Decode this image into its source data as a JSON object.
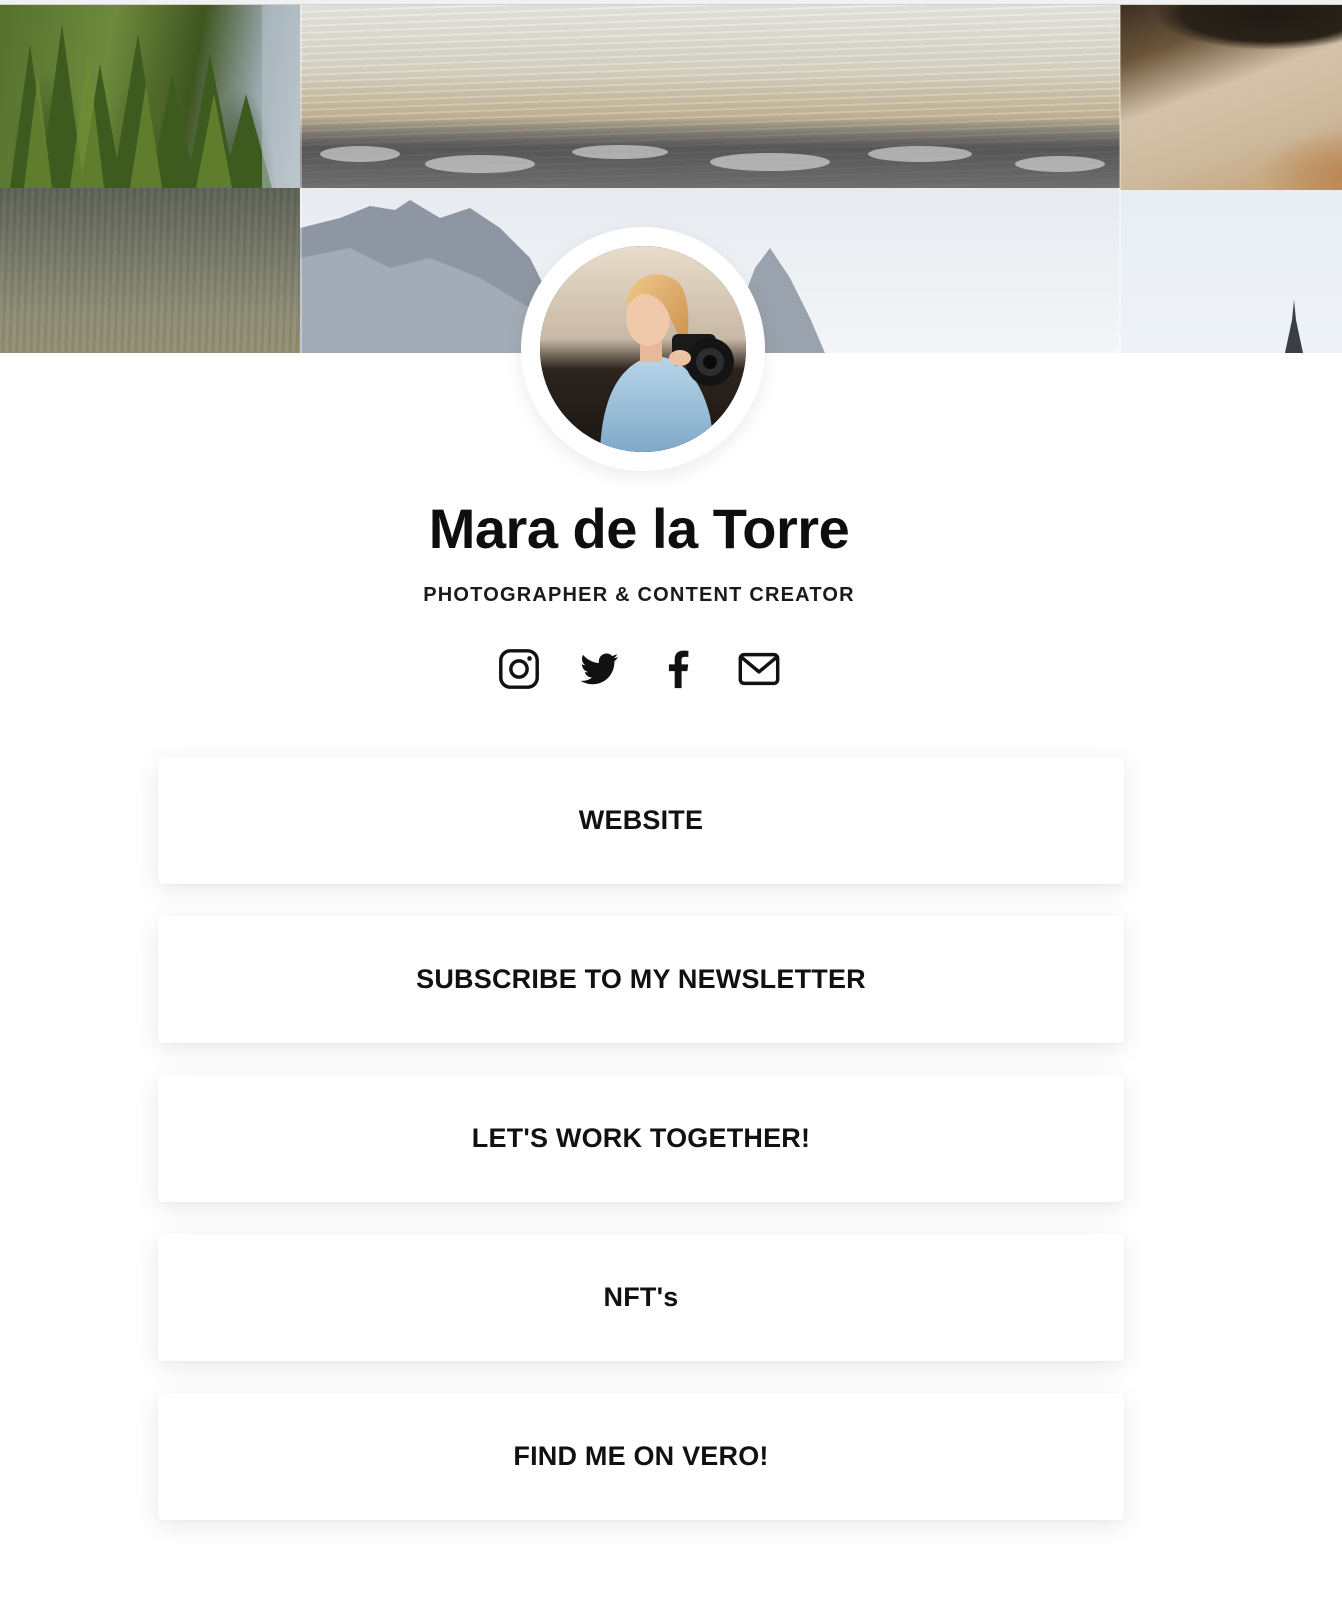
{
  "profile": {
    "name": "Mara de la Torre",
    "tagline": "PHOTOGRAPHER & CONTENT CREATOR"
  },
  "header": {
    "tiles": [
      "forest",
      "sea",
      "beach",
      "cliff",
      "mountain",
      "sky"
    ]
  },
  "social": [
    {
      "icon": "instagram-icon"
    },
    {
      "icon": "twitter-icon"
    },
    {
      "icon": "facebook-icon"
    },
    {
      "icon": "mail-icon"
    }
  ],
  "links": [
    {
      "label": "WEBSITE"
    },
    {
      "label": "SUBSCRIBE TO MY NEWSLETTER"
    },
    {
      "label": "LET'S WORK TOGETHER!"
    },
    {
      "label": "NFT's"
    },
    {
      "label": "FIND ME ON VERO!"
    }
  ],
  "colors": {
    "text": "#111111",
    "background": "#ffffff",
    "button": "#ffffff"
  }
}
